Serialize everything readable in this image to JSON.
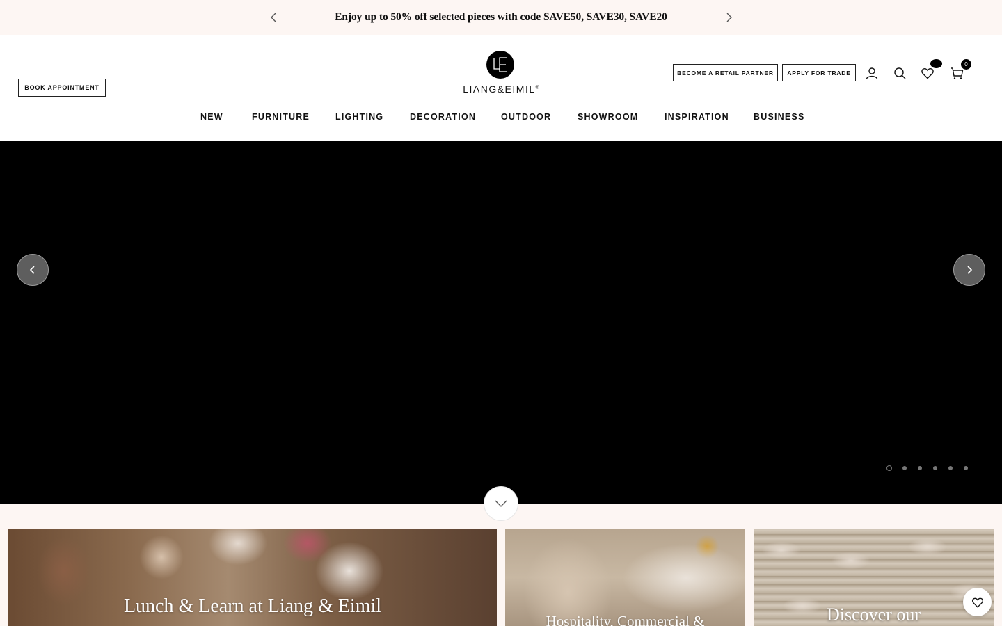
{
  "announcement": {
    "text": "Enjoy up to 50% off selected pieces with code SAVE50, SAVE30, SAVE20",
    "prev_icon": "chevron-left-icon",
    "next_icon": "chevron-right-icon"
  },
  "header": {
    "book_appointment": "BOOK APPOINTMENT",
    "logo": {
      "monogram": "LE",
      "wordmark": "LIANG&EIMIL",
      "registered": "®"
    },
    "become_partner": "BECOME A RETAIL PARTNER",
    "apply_trade": "APPLY FOR TRADE",
    "icons": [
      "account-icon",
      "search-icon",
      "heart-icon",
      "cart-icon"
    ],
    "cart_count": "0"
  },
  "nav": {
    "items": [
      {
        "label": "NEW"
      },
      {
        "label": "FURNITURE"
      },
      {
        "label": "LIGHTING"
      },
      {
        "label": "DECORATION"
      },
      {
        "label": "OUTDOOR"
      },
      {
        "label": "SHOWROOM"
      },
      {
        "label": "INSPIRATION"
      },
      {
        "label": "BUSINESS"
      }
    ]
  },
  "hero": {
    "slide_count": 6,
    "active_slide": 1,
    "background": "#000000"
  },
  "cards": [
    {
      "title": "Lunch & Learn at Liang & Eimil"
    },
    {
      "title": "Hospitality, Commercial &"
    },
    {
      "title": "Discover our"
    }
  ],
  "colors": {
    "announcement_bg": "#fdf6f3",
    "section_bg": "#fdf6f3",
    "text": "#111111"
  }
}
